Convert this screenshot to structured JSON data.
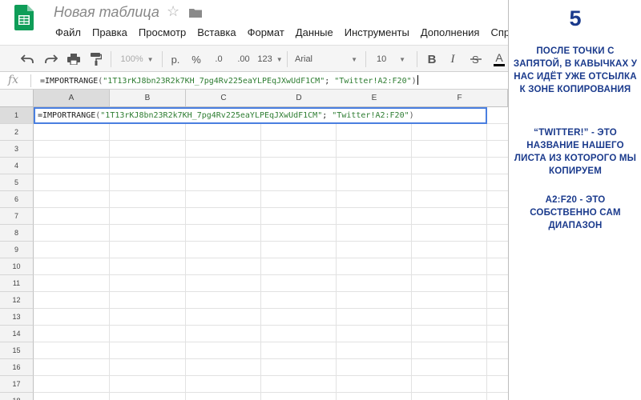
{
  "header": {
    "title": "Новая таблица",
    "menu": [
      "Файл",
      "Правка",
      "Просмотр",
      "Вставка",
      "Формат",
      "Данные",
      "Инструменты",
      "Дополнения",
      "Справка"
    ]
  },
  "toolbar": {
    "zoom": "100%",
    "currency": "р.",
    "percent": "%",
    "decimal_decrease": ".0",
    "decimal_increase": ".00",
    "number_format": "123",
    "font": "Arial",
    "font_size": "10",
    "bold": "B",
    "italic": "I",
    "text_color": "A"
  },
  "formula_bar": {
    "fx_label": "fx",
    "fn": "=IMPORTRANGE",
    "open": "(",
    "arg1": "\"1T13rKJ8bn23R2k7KH_7pg4Rv225eaYLPEqJXwUdF1CM\"",
    "sep": "; ",
    "arg2": "\"Twitter!A2:F20\"",
    "close": ")"
  },
  "grid": {
    "columns": [
      "A",
      "B",
      "C",
      "D",
      "E",
      "F"
    ],
    "rows": [
      "1",
      "2",
      "3",
      "4",
      "5",
      "6",
      "7",
      "8",
      "9",
      "10",
      "11",
      "12",
      "13",
      "14",
      "15",
      "16",
      "17",
      "18"
    ],
    "active_column": "A",
    "active_row": "1"
  },
  "annotation": {
    "step": "5",
    "text1": "после точки с запятой, в кавычках у нас идёт уже отсылка к зоне копирования",
    "text2": "“Twitter!” - это название нашего листа из которого мы копируем",
    "text3": "A2:F20 - это собственно сам диапазон"
  },
  "colors": {
    "accent_blue": "#4a7fe0",
    "annotation_blue": "#1a3a8c",
    "string_green": "#2e7d32",
    "sheets_green": "#0f9d58"
  }
}
